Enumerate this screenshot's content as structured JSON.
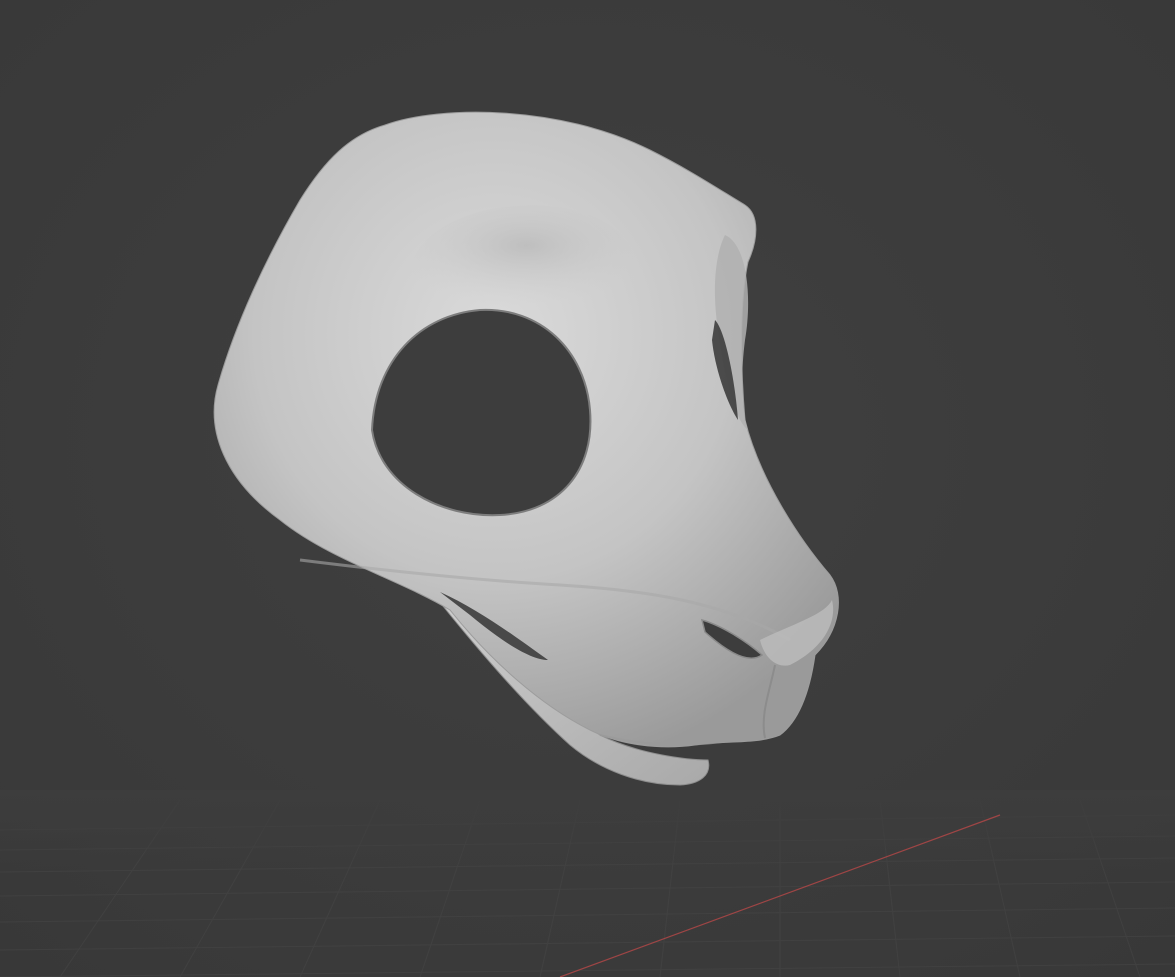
{
  "viewport": {
    "background_color": "#3d3d3d",
    "grid_color": "#474747",
    "x_axis_color": "#b84848",
    "mesh_color": "#c8c8c8",
    "mesh_shadow_color": "#8f8f8f",
    "mesh_highlight_color": "#e2e2e2",
    "hole_color": "#3d3d3d"
  },
  "model": {
    "icon": "sculpted-mask-mesh"
  }
}
